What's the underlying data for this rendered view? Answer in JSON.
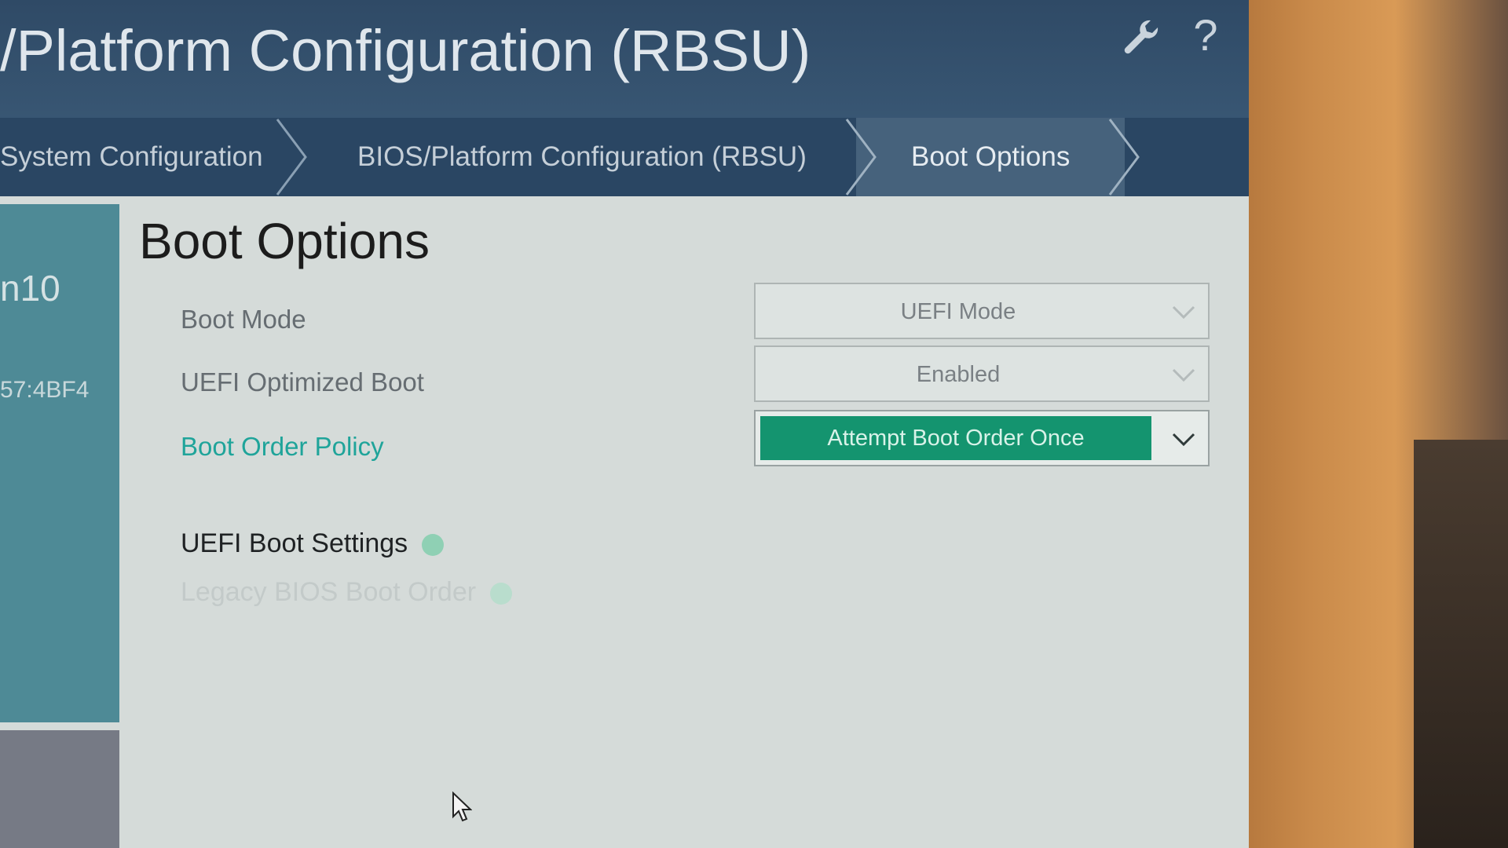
{
  "header": {
    "title": "/Platform Configuration (RBSU)"
  },
  "breadcrumb": {
    "items": [
      {
        "label": "System Configuration"
      },
      {
        "label": "BIOS/Platform Configuration (RBSU)"
      },
      {
        "label": "Boot Options"
      }
    ]
  },
  "sidebar": {
    "server_name": "n10",
    "id_fragment": "57:4BF4"
  },
  "main": {
    "heading": "Boot Options",
    "settings": [
      {
        "label": "Boot Mode",
        "value": "UEFI Mode"
      },
      {
        "label": "UEFI Optimized Boot",
        "value": "Enabled"
      },
      {
        "label": "Boot Order Policy",
        "value": "Attempt Boot Order Once"
      }
    ],
    "links": [
      {
        "label": "UEFI Boot Settings"
      },
      {
        "label": "Legacy BIOS Boot Order"
      }
    ]
  },
  "icons": {
    "settings": "wrench-icon",
    "help": "question-mark-icon"
  },
  "colors": {
    "header_bg": "#2f4a66",
    "breadcrumb_bg": "#2a4663",
    "accent": "#14946f",
    "focus_text": "#1fa49a"
  }
}
